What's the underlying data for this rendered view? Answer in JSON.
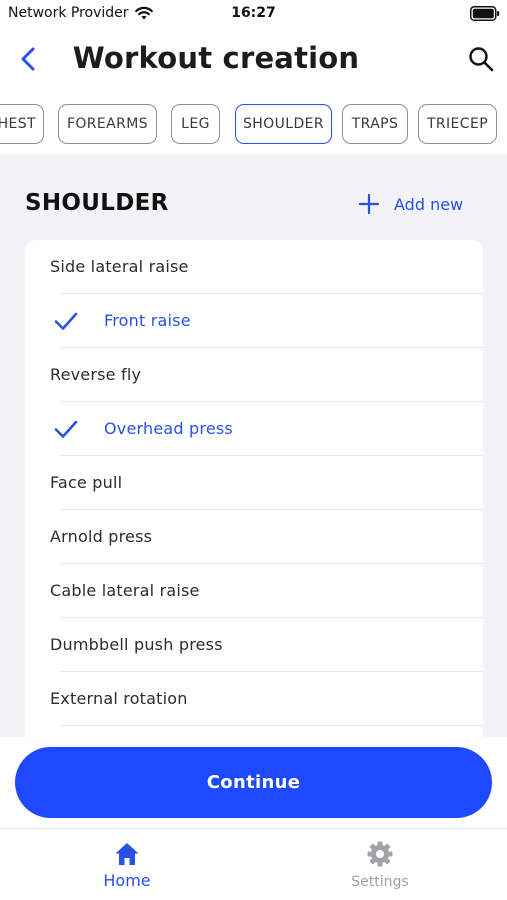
{
  "status_bar": {
    "carrier": "Network Provider",
    "time": "16:27"
  },
  "header": {
    "title": "Workout creation"
  },
  "categories": [
    {
      "label": "HEST"
    },
    {
      "label": "FOREARMS"
    },
    {
      "label": "LEG"
    },
    {
      "label": "SHOULDER",
      "selected": true
    },
    {
      "label": "TRAPS"
    },
    {
      "label": "TRIECEP"
    }
  ],
  "section": {
    "title": "SHOULDER",
    "add_new_label": "Add new"
  },
  "exercises": [
    {
      "label": "Side lateral raise",
      "checked": false
    },
    {
      "label": "Front raise",
      "checked": true
    },
    {
      "label": "Reverse fly",
      "checked": false
    },
    {
      "label": "Overhead press",
      "checked": true
    },
    {
      "label": "Face pull",
      "checked": false
    },
    {
      "label": "Arnold press",
      "checked": false
    },
    {
      "label": "Cable lateral raise",
      "checked": false
    },
    {
      "label": "Dumbbell push press",
      "checked": false
    },
    {
      "label": "External rotation",
      "checked": false
    }
  ],
  "continue_label": "Continue",
  "tabs": [
    {
      "label": "Home",
      "icon": "home-icon",
      "active": true
    },
    {
      "label": "Settings",
      "icon": "gear-icon",
      "active": false
    }
  ],
  "colors": {
    "accent": "#2852e6",
    "primary_button": "#1f49ff",
    "background": "#f2f2f7",
    "inactive": "#a1a1a6"
  }
}
